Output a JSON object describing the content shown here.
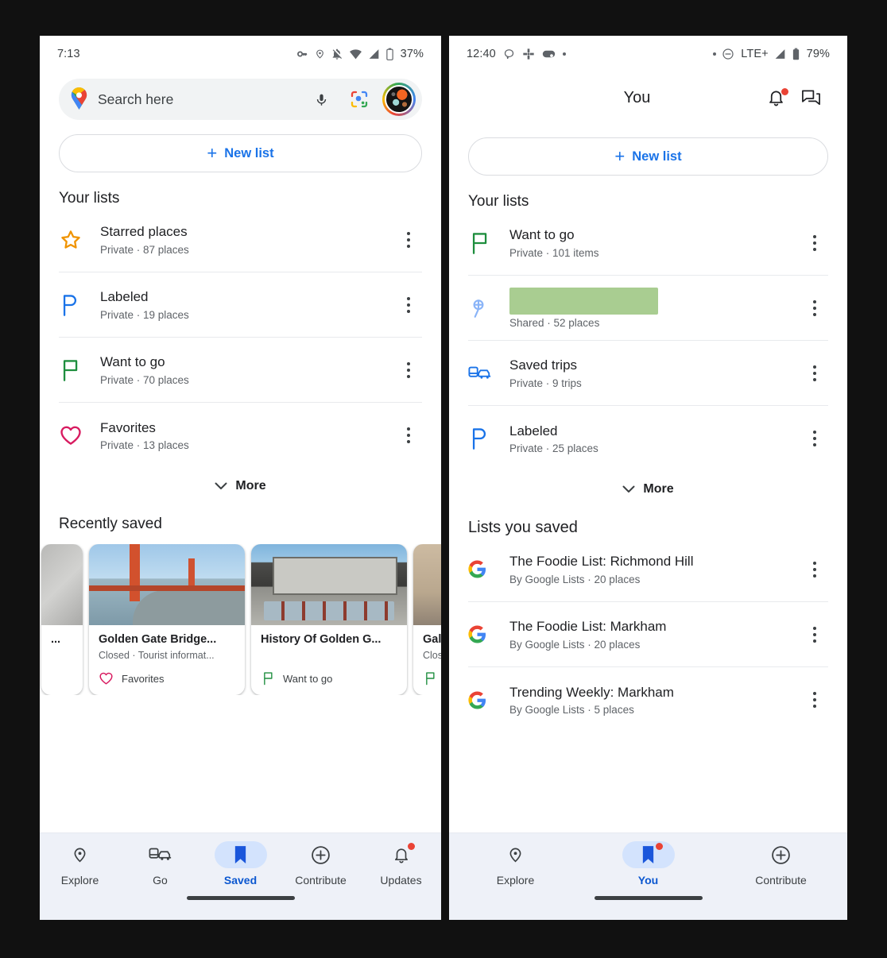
{
  "left_phone": {
    "status_bar": {
      "time": "7:13",
      "battery_pct": "37%",
      "icons": [
        "vpn-key-icon",
        "location-pin-icon",
        "notifications-muted-icon",
        "wifi-icon",
        "cell-signal-icon",
        "battery-icon"
      ]
    },
    "search": {
      "placeholder": "Search here",
      "map_pin_icon": "google-maps-pin-icon",
      "mic_icon": "microphone-icon",
      "lens_icon": "google-lens-icon",
      "avatar_icon": "account-avatar"
    },
    "new_list_label": "New list",
    "your_lists_title": "Your lists",
    "lists": [
      {
        "icon": "star-icon",
        "icon_color": "#f09300",
        "title": "Starred places",
        "subtitle": "Private · 87 places"
      },
      {
        "icon": "label-flag-icon",
        "icon_color": "#1a73e8",
        "title": "Labeled",
        "subtitle": "Private · 19 places"
      },
      {
        "icon": "flag-icon",
        "icon_color": "#1e8e3e",
        "title": "Want to go",
        "subtitle": "Private · 70 places"
      },
      {
        "icon": "heart-icon",
        "icon_color": "#d81b60",
        "title": "Favorites",
        "subtitle": "Private · 13 places"
      }
    ],
    "more_label": "More",
    "recently_saved_title": "Recently saved",
    "cards": [
      {
        "title": "",
        "subtitle": "",
        "tag": "",
        "tag_icon": "",
        "variant": "partial-left",
        "image": "stone-wall-photo",
        "ellipsis": "..."
      },
      {
        "title": "Golden Gate Bridge...",
        "subtitle": "Closed · Tourist informat...",
        "tag": "Favorites",
        "tag_icon": "heart-icon",
        "tag_color": "#d81b60",
        "variant": "full",
        "image": "golden-gate-bridge-photo"
      },
      {
        "title": "History Of Golden G...",
        "subtitle": "",
        "tag": "Want to go",
        "tag_icon": "flag-icon",
        "tag_color": "#1e8e3e",
        "variant": "full",
        "image": "history-sign-photo"
      },
      {
        "title": "Gale",
        "subtitle": "Clos",
        "tag": "",
        "tag_icon": "flag-icon",
        "tag_color": "#1e8e3e",
        "variant": "partial-right",
        "image": "building-photo"
      }
    ],
    "nav": [
      {
        "label": "Explore",
        "icon": "location-pin-icon",
        "active": false,
        "badge": false
      },
      {
        "label": "Go",
        "icon": "transit-car-icon",
        "active": false,
        "badge": false
      },
      {
        "label": "Saved",
        "icon": "bookmark-icon",
        "active": true,
        "badge": false
      },
      {
        "label": "Contribute",
        "icon": "plus-circle-icon",
        "active": false,
        "badge": false
      },
      {
        "label": "Updates",
        "icon": "bell-icon",
        "active": false,
        "badge": true
      }
    ]
  },
  "right_phone": {
    "status_bar": {
      "time": "12:40",
      "battery_pct": "79%",
      "network": "LTE+",
      "icons": [
        "chat-bubble-icon",
        "slack-icon",
        "game-controller-icon",
        "dot-icon",
        "dot-icon",
        "do-not-disturb-icon",
        "cell-signal-icon",
        "battery-icon"
      ]
    },
    "header": {
      "title": "You",
      "bell_icon": "notifications-bell-icon",
      "bell_badge": true,
      "messages_icon": "messages-icon"
    },
    "new_list_label": "New list",
    "your_lists_title": "Your lists",
    "lists": [
      {
        "icon": "flag-icon",
        "icon_color": "#1e8e3e",
        "title": "Want to go",
        "subtitle": "Private · 101 items",
        "redacted": false
      },
      {
        "icon": "shared-pin-icon",
        "icon_color": "#8ab4f8",
        "title": "",
        "subtitle": "Shared · 52 places",
        "redacted": true,
        "redaction_color": "#a9cd91"
      },
      {
        "icon": "trip-car-icon",
        "icon_color": "#1a73e8",
        "title": "Saved trips",
        "subtitle": "Private · 9 trips",
        "redacted": false
      },
      {
        "icon": "label-flag-icon",
        "icon_color": "#1a73e8",
        "title": "Labeled",
        "subtitle": "Private · 25 places",
        "redacted": false
      }
    ],
    "more_label": "More",
    "lists_you_saved_title": "Lists you saved",
    "saved_lists": [
      {
        "icon": "google-g-icon",
        "title": "The Foodie List: Richmond Hill",
        "subtitle": "By Google Lists · 20 places"
      },
      {
        "icon": "google-g-icon",
        "title": "The Foodie List: Markham",
        "subtitle": "By Google Lists · 20 places"
      },
      {
        "icon": "google-g-icon",
        "title": "Trending Weekly: Markham",
        "subtitle": "By Google Lists · 5 places"
      }
    ],
    "nav": [
      {
        "label": "Explore",
        "icon": "location-pin-icon",
        "active": false,
        "badge": false
      },
      {
        "label": "You",
        "icon": "bookmark-icon",
        "active": true,
        "badge": true
      },
      {
        "label": "Contribute",
        "icon": "plus-circle-icon",
        "active": false,
        "badge": false
      }
    ]
  },
  "colors": {
    "accent_blue": "#1a73e8",
    "active_blue": "#0b57d0",
    "pill_blue": "#d3e3fd",
    "nav_bg": "#eef1f8",
    "badge_red": "#ea4335",
    "redaction_green": "#a9cd91"
  }
}
